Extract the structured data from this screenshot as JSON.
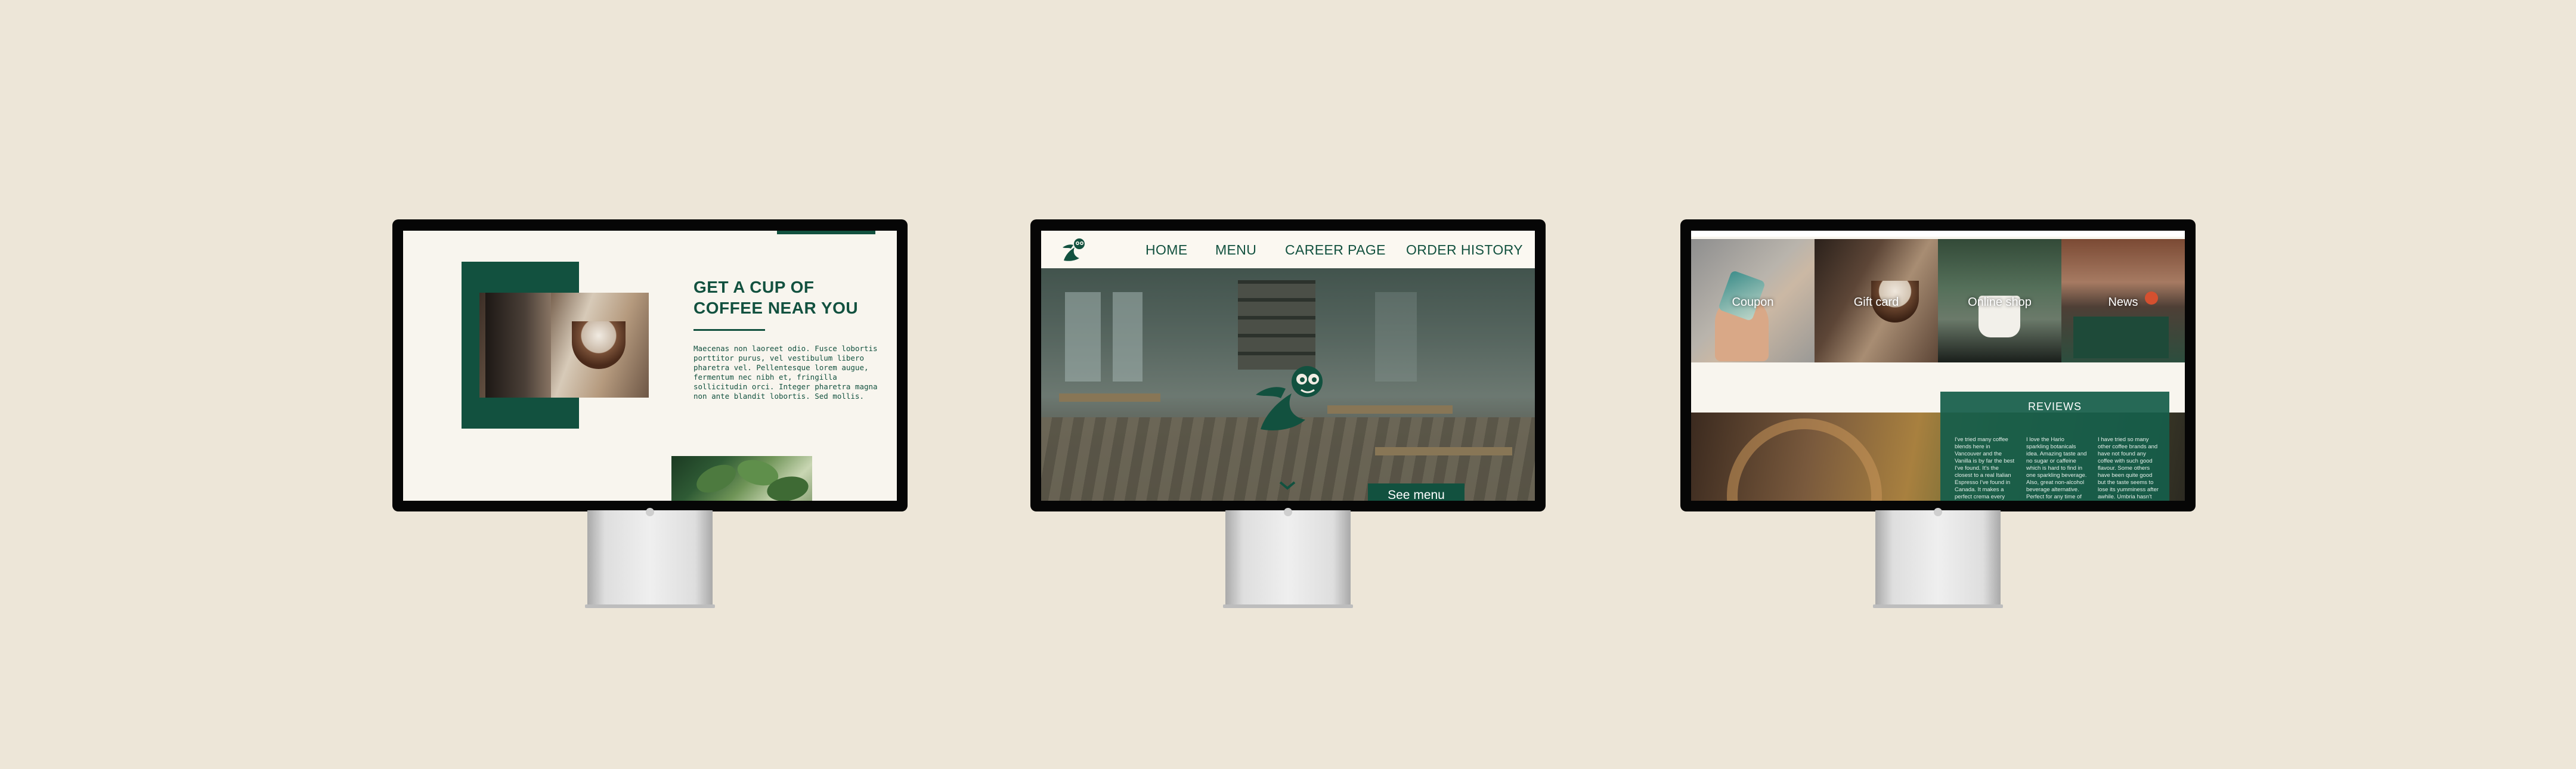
{
  "colors": {
    "background": "#ede6d8",
    "brand_green": "#12513f",
    "cream": "#f8f5ee"
  },
  "screen1": {
    "headline_line1": "GET A CUP OF",
    "headline_line2": "COFFEE NEAR YOU",
    "body": "Maecenas non laoreet odio. Fusce lobortis porttitor purus, vel vestibulum libero pharetra vel. Pellentesque lorem augue, fermentum nec nibh et, fringilla sollicitudin orci. Integer pharetra magna non ante blandit lobortis. Sed mollis."
  },
  "screen2": {
    "nav": [
      {
        "label": "HOME"
      },
      {
        "label": "MENU"
      },
      {
        "label": "CAREER PAGE"
      },
      {
        "label": "ORDER HISTORY"
      }
    ],
    "cta_label": "See menu",
    "icons": {
      "logo": "mascot-logo-icon",
      "scroll": "chevron-down-icon"
    }
  },
  "screen3": {
    "tiles": [
      {
        "label": "Coupon"
      },
      {
        "label": "Gift card"
      },
      {
        "label": "Online shop"
      },
      {
        "label": "News"
      }
    ],
    "reviews_title": "REVIEWS",
    "reviews": [
      "I've tried many coffee blends here in Vancouver and the Vanilla is by far the best I've found. It's the closest to a real Italian Espresso I've found in Canada. It makes a perfect crema every",
      "I love the Hario sparkling botanicals idea. Amazing taste and no sugar or caffeine which is hard to find in one sparkling beverage. Also, great non-alcohol beverage alternative. Perfect for any time of the",
      "I have tried so many other coffee brands and have not found any coffee with such good flavour. Some others have been quite good but the taste seems to lose its yumminess after awhile. Umbria hasn't done"
    ]
  }
}
